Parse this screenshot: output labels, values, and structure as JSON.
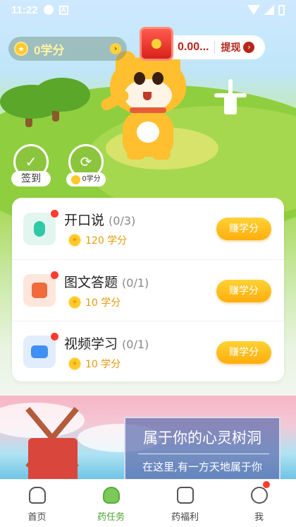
{
  "status_bar": {
    "time": "11:22"
  },
  "header": {
    "points_value": "0学分",
    "cash_amount": "0.00...",
    "withdraw_label": "提现"
  },
  "quick_actions": [
    {
      "label": "签到"
    },
    {
      "label": "0学分"
    }
  ],
  "tasks": [
    {
      "title": "开口说",
      "progress": "(0/3)",
      "reward": "120 学分",
      "button": "赚学分",
      "icon": "microphone-icon",
      "color": "#2fc9a6",
      "bg": "#e2f6ef"
    },
    {
      "title": "图文答题",
      "progress": "(0/1)",
      "reward": "10 学分",
      "button": "赚学分",
      "icon": "quiz-icon",
      "color": "#f06a3c",
      "bg": "#fde6dc"
    },
    {
      "title": "视频学习",
      "progress": "(0/1)",
      "reward": "10 学分",
      "button": "赚学分",
      "icon": "video-icon",
      "color": "#3f8ff5",
      "bg": "#e1edfc"
    }
  ],
  "banner": {
    "headline": "属于你的心灵树洞",
    "subline": "在这里,有一方天地属于你"
  },
  "bottom_nav": [
    {
      "label": "首页",
      "icon": "home-icon",
      "active": false
    },
    {
      "label": "药任务",
      "icon": "tasks-icon",
      "active": true
    },
    {
      "label": "药福利",
      "icon": "welfare-icon",
      "active": false
    },
    {
      "label": "我",
      "icon": "profile-icon",
      "active": false,
      "badge": true
    }
  ],
  "colors": {
    "accent_green": "#4aa22e",
    "earn_button": "#ffbe1e",
    "coin": "#ffc928",
    "cash_red": "#b7251b"
  }
}
